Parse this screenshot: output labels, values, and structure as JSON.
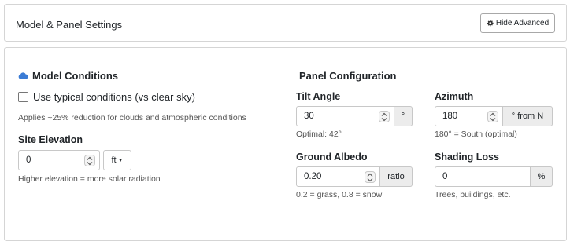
{
  "header": {
    "title": "Model & Panel Settings",
    "toggle_button": {
      "icon": "gear-icon",
      "label": "Hide Advanced"
    }
  },
  "model": {
    "title": "Model Conditions",
    "icon": "cloud-icon",
    "icon_color": "#3a7bd5",
    "typical_conditions": {
      "label": "Use typical conditions (vs clear sky)",
      "checked": false
    },
    "typical_help": "Applies ~25% reduction for clouds and atmospheric conditions",
    "elevation": {
      "label": "Site Elevation",
      "value": "0",
      "unit": "ft",
      "help": "Higher elevation = more solar radiation"
    }
  },
  "panel": {
    "title": "Panel Configuration",
    "tilt": {
      "label": "Tilt Angle",
      "value": "30",
      "unit": "°",
      "help": "Optimal: 42°"
    },
    "azimuth": {
      "label": "Azimuth",
      "value": "180",
      "unit": "° from N",
      "help": "180° = South (optimal)"
    },
    "albedo": {
      "label": "Ground Albedo",
      "value": "0.20",
      "unit": "ratio",
      "help": "0.2 = grass, 0.8 = snow"
    },
    "shading": {
      "label": "Shading Loss",
      "value": "0",
      "unit": "%",
      "help": "Trees, buildings, etc."
    }
  }
}
